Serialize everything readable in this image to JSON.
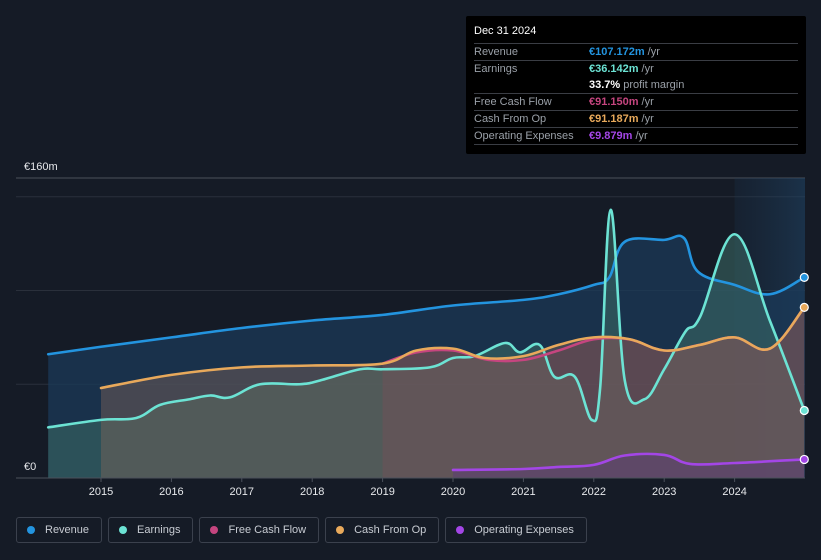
{
  "tooltip": {
    "date": "Dec 31 2024",
    "rows": [
      {
        "label": "Revenue",
        "value": "€107.172m",
        "unit": "/yr",
        "color": "#2394df"
      },
      {
        "label": "Earnings",
        "value": "€36.142m",
        "unit": "/yr",
        "color": "#6ce3d4"
      },
      {
        "label": "",
        "value": "33.7%",
        "unit": "profit margin",
        "color": "#ffffff"
      },
      {
        "label": "Free Cash Flow",
        "value": "€91.150m",
        "unit": "/yr",
        "color": "#c5457f"
      },
      {
        "label": "Cash From Op",
        "value": "€91.187m",
        "unit": "/yr",
        "color": "#e8a95b"
      },
      {
        "label": "Operating Expenses",
        "value": "€9.879m",
        "unit": "/yr",
        "color": "#a346e6"
      }
    ]
  },
  "legend": [
    {
      "label": "Revenue",
      "color": "#2394df"
    },
    {
      "label": "Earnings",
      "color": "#6ce3d4"
    },
    {
      "label": "Free Cash Flow",
      "color": "#c5457f"
    },
    {
      "label": "Cash From Op",
      "color": "#e8a95b"
    },
    {
      "label": "Operating Expenses",
      "color": "#a346e6"
    }
  ],
  "chart_data": {
    "type": "line",
    "title": "",
    "xlabel": "",
    "ylabel": "",
    "y_tick_labels": [
      "€0",
      "€160m"
    ],
    "ylim": [
      0,
      160
    ],
    "y_unit": "€m",
    "x_tick_labels": [
      "2015",
      "2016",
      "2017",
      "2018",
      "2019",
      "2020",
      "2021",
      "2022",
      "2023",
      "2024"
    ],
    "xlim": [
      2014.25,
      2024.99
    ],
    "grid": true,
    "legend_position": "bottom",
    "highlight_from": 2024.0,
    "series": [
      {
        "name": "Revenue",
        "color": "#2394df",
        "x": [
          2014.25,
          2015.0,
          2016.0,
          2017.0,
          2018.0,
          2019.0,
          2020.0,
          2021.0,
          2021.5,
          2022.0,
          2022.22,
          2022.44,
          2023.0,
          2023.28,
          2023.48,
          2024.0,
          2024.5,
          2024.99
        ],
        "y": [
          66,
          70,
          75,
          80,
          84,
          87,
          92,
          95,
          98,
          103,
          107,
          126,
          127,
          128,
          110,
          103,
          98,
          107
        ]
      },
      {
        "name": "Earnings",
        "color": "#6ce3d4",
        "x": [
          2014.25,
          2015.0,
          2015.5,
          2015.84,
          2016.26,
          2016.55,
          2016.83,
          2017.26,
          2017.82,
          2018.11,
          2018.68,
          2019.0,
          2019.67,
          2020.0,
          2020.31,
          2020.74,
          2020.95,
          2021.23,
          2021.44,
          2021.73,
          2021.97,
          2022.09,
          2022.24,
          2022.44,
          2022.72,
          2023.0,
          2023.3,
          2023.51,
          2024.0,
          2024.5,
          2024.99
        ],
        "y": [
          27,
          31,
          32,
          39,
          42,
          44,
          43,
          50,
          50,
          52,
          58,
          58,
          59,
          64,
          65,
          72,
          67,
          71,
          54,
          54,
          31,
          48,
          143,
          52,
          42,
          58,
          78,
          86,
          130,
          84,
          36
        ]
      },
      {
        "name": "Free Cash Flow",
        "color": "#c5457f",
        "x": [
          2019.0,
          2019.48,
          2020.0,
          2020.5,
          2021.0,
          2021.5,
          2022.0,
          2022.5,
          2023.0,
          2023.5,
          2024.0,
          2024.5,
          2024.99
        ],
        "y": [
          61,
          67,
          68,
          63,
          63,
          68,
          74,
          74,
          68,
          71,
          75,
          69,
          91
        ]
      },
      {
        "name": "Cash From Op",
        "color": "#e8a95b",
        "x": [
          2015.0,
          2016.0,
          2017.0,
          2018.0,
          2019.0,
          2019.48,
          2020.0,
          2020.45,
          2021.0,
          2021.5,
          2022.0,
          2022.51,
          2023.0,
          2023.51,
          2024.0,
          2024.5,
          2024.99
        ],
        "y": [
          48,
          55,
          59,
          60,
          61,
          68,
          69,
          64,
          65,
          71,
          75,
          74,
          68,
          71,
          75,
          69,
          91
        ]
      },
      {
        "name": "Operating Expenses",
        "color": "#a346e6",
        "x": [
          2020.0,
          2021.0,
          2021.5,
          2022.0,
          2022.44,
          2023.0,
          2023.37,
          2024.0,
          2024.99
        ],
        "y": [
          4.3,
          4.8,
          5.9,
          7.0,
          12.0,
          12.3,
          7.5,
          8.0,
          9.9
        ]
      }
    ]
  }
}
